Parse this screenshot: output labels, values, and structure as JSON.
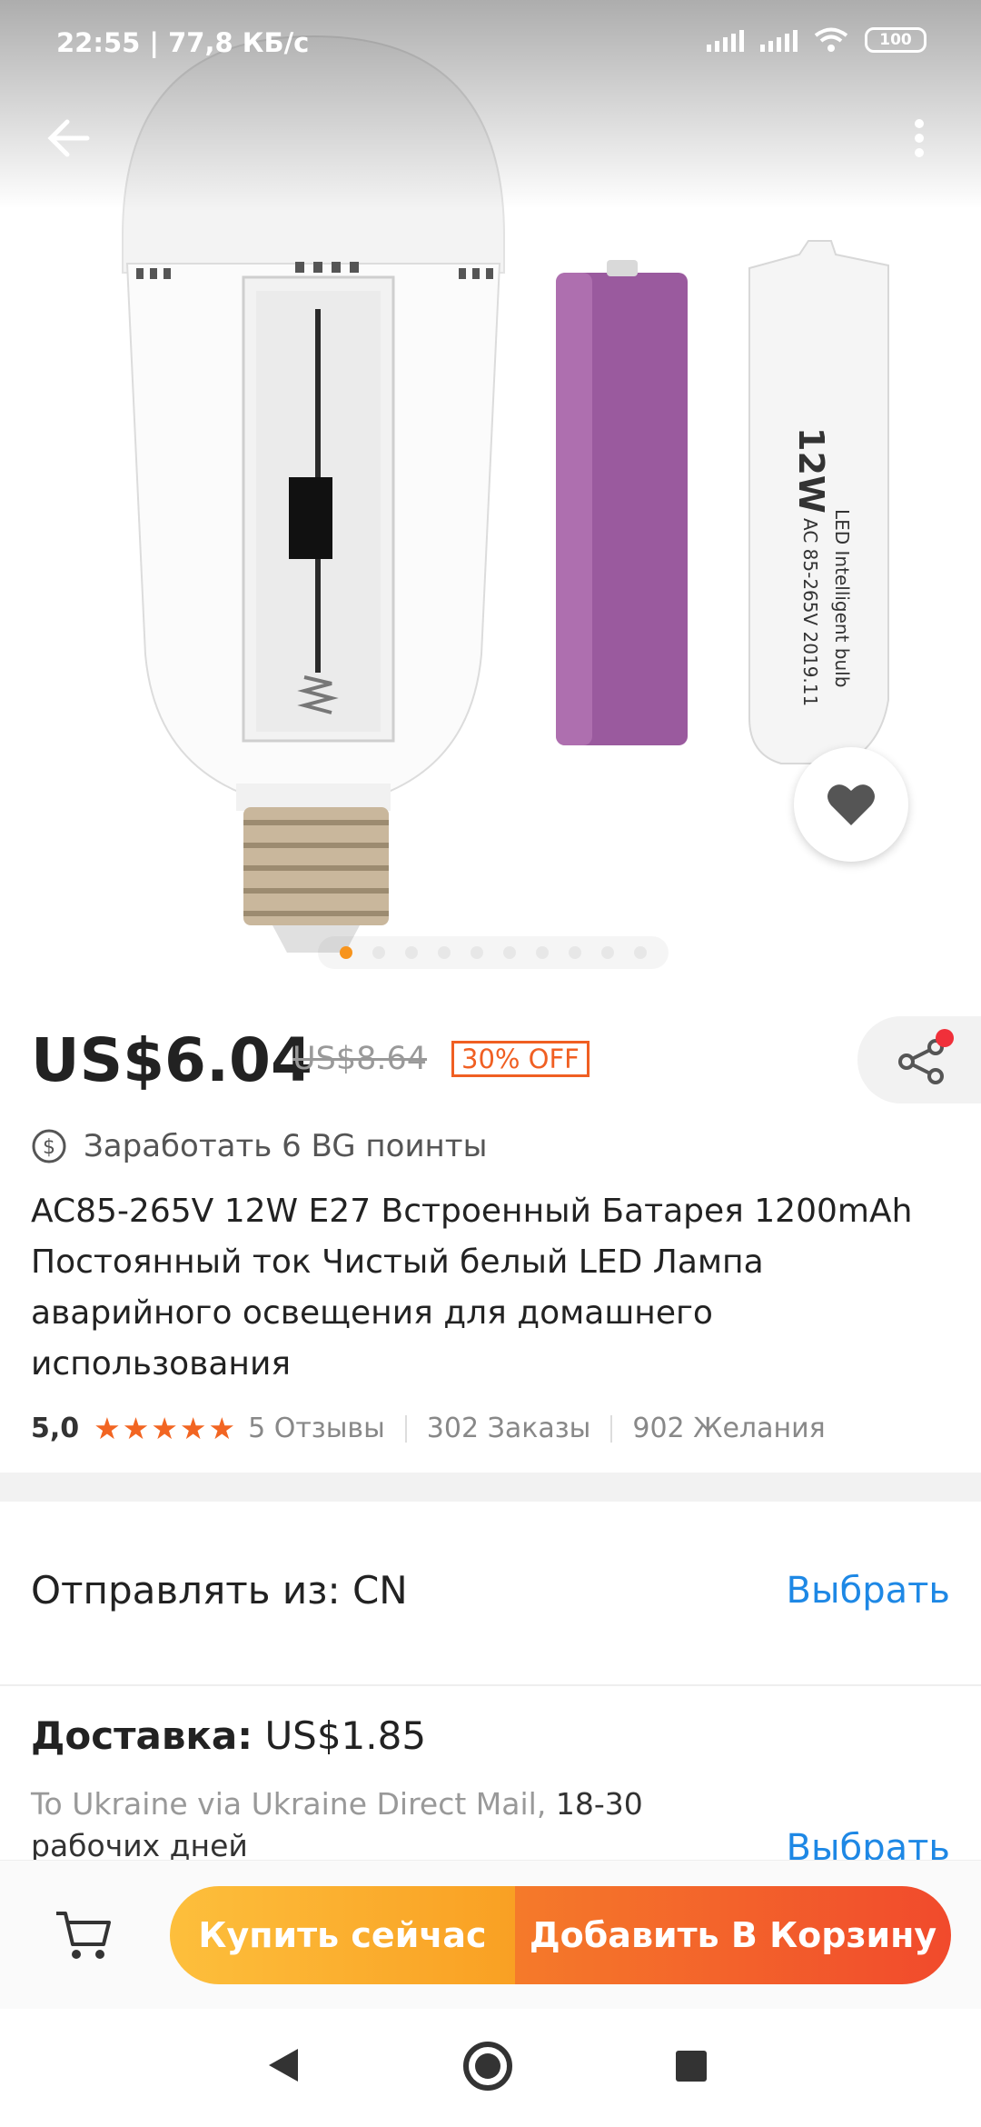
{
  "status_bar": {
    "time": "22:55",
    "speed": "77,8 КБ/с",
    "battery": "100"
  },
  "gallery": {
    "image_count": 10,
    "active_index": 0
  },
  "price": {
    "current": "US$6.04",
    "original": "US$8.64",
    "discount": "30% OFF"
  },
  "points": {
    "text": "Заработать 6 BG поинты"
  },
  "product": {
    "title": "AC85-265V 12W E27 Встроенный Батарея 1200mAh Постоянный ток Чистый белый LED Лампа аварийного освещения для домашнего использования",
    "rating": "5,0",
    "stars": 5,
    "reviews": "5 Отзывы",
    "orders": "302 Заказы",
    "wishes": "902 Желания"
  },
  "shipping": {
    "from_label": "Отправлять из: CN",
    "select_label": "Выбрать",
    "delivery_label": "Доставка:",
    "delivery_price": "US$1.85",
    "method": "To Ukraine via Ukraine Direct Mail,",
    "time": "18-30 рабочих дней",
    "select_label_2": "Выбрать"
  },
  "actions": {
    "buy_now": "Купить сейчас",
    "add_to_cart": "Добавить В Корзину"
  },
  "colors": {
    "accent_orange": "#f05f22",
    "link_blue": "#1e88e5",
    "buy_yellow": "#fdbf3c",
    "cart_red": "#f14a2c"
  },
  "icons": [
    "back-arrow-icon",
    "more-vertical-icon",
    "heart-icon",
    "share-icon",
    "dollar-coin-icon",
    "star-icon",
    "cart-icon",
    "nav-back-icon",
    "nav-home-icon",
    "nav-recent-icon"
  ]
}
